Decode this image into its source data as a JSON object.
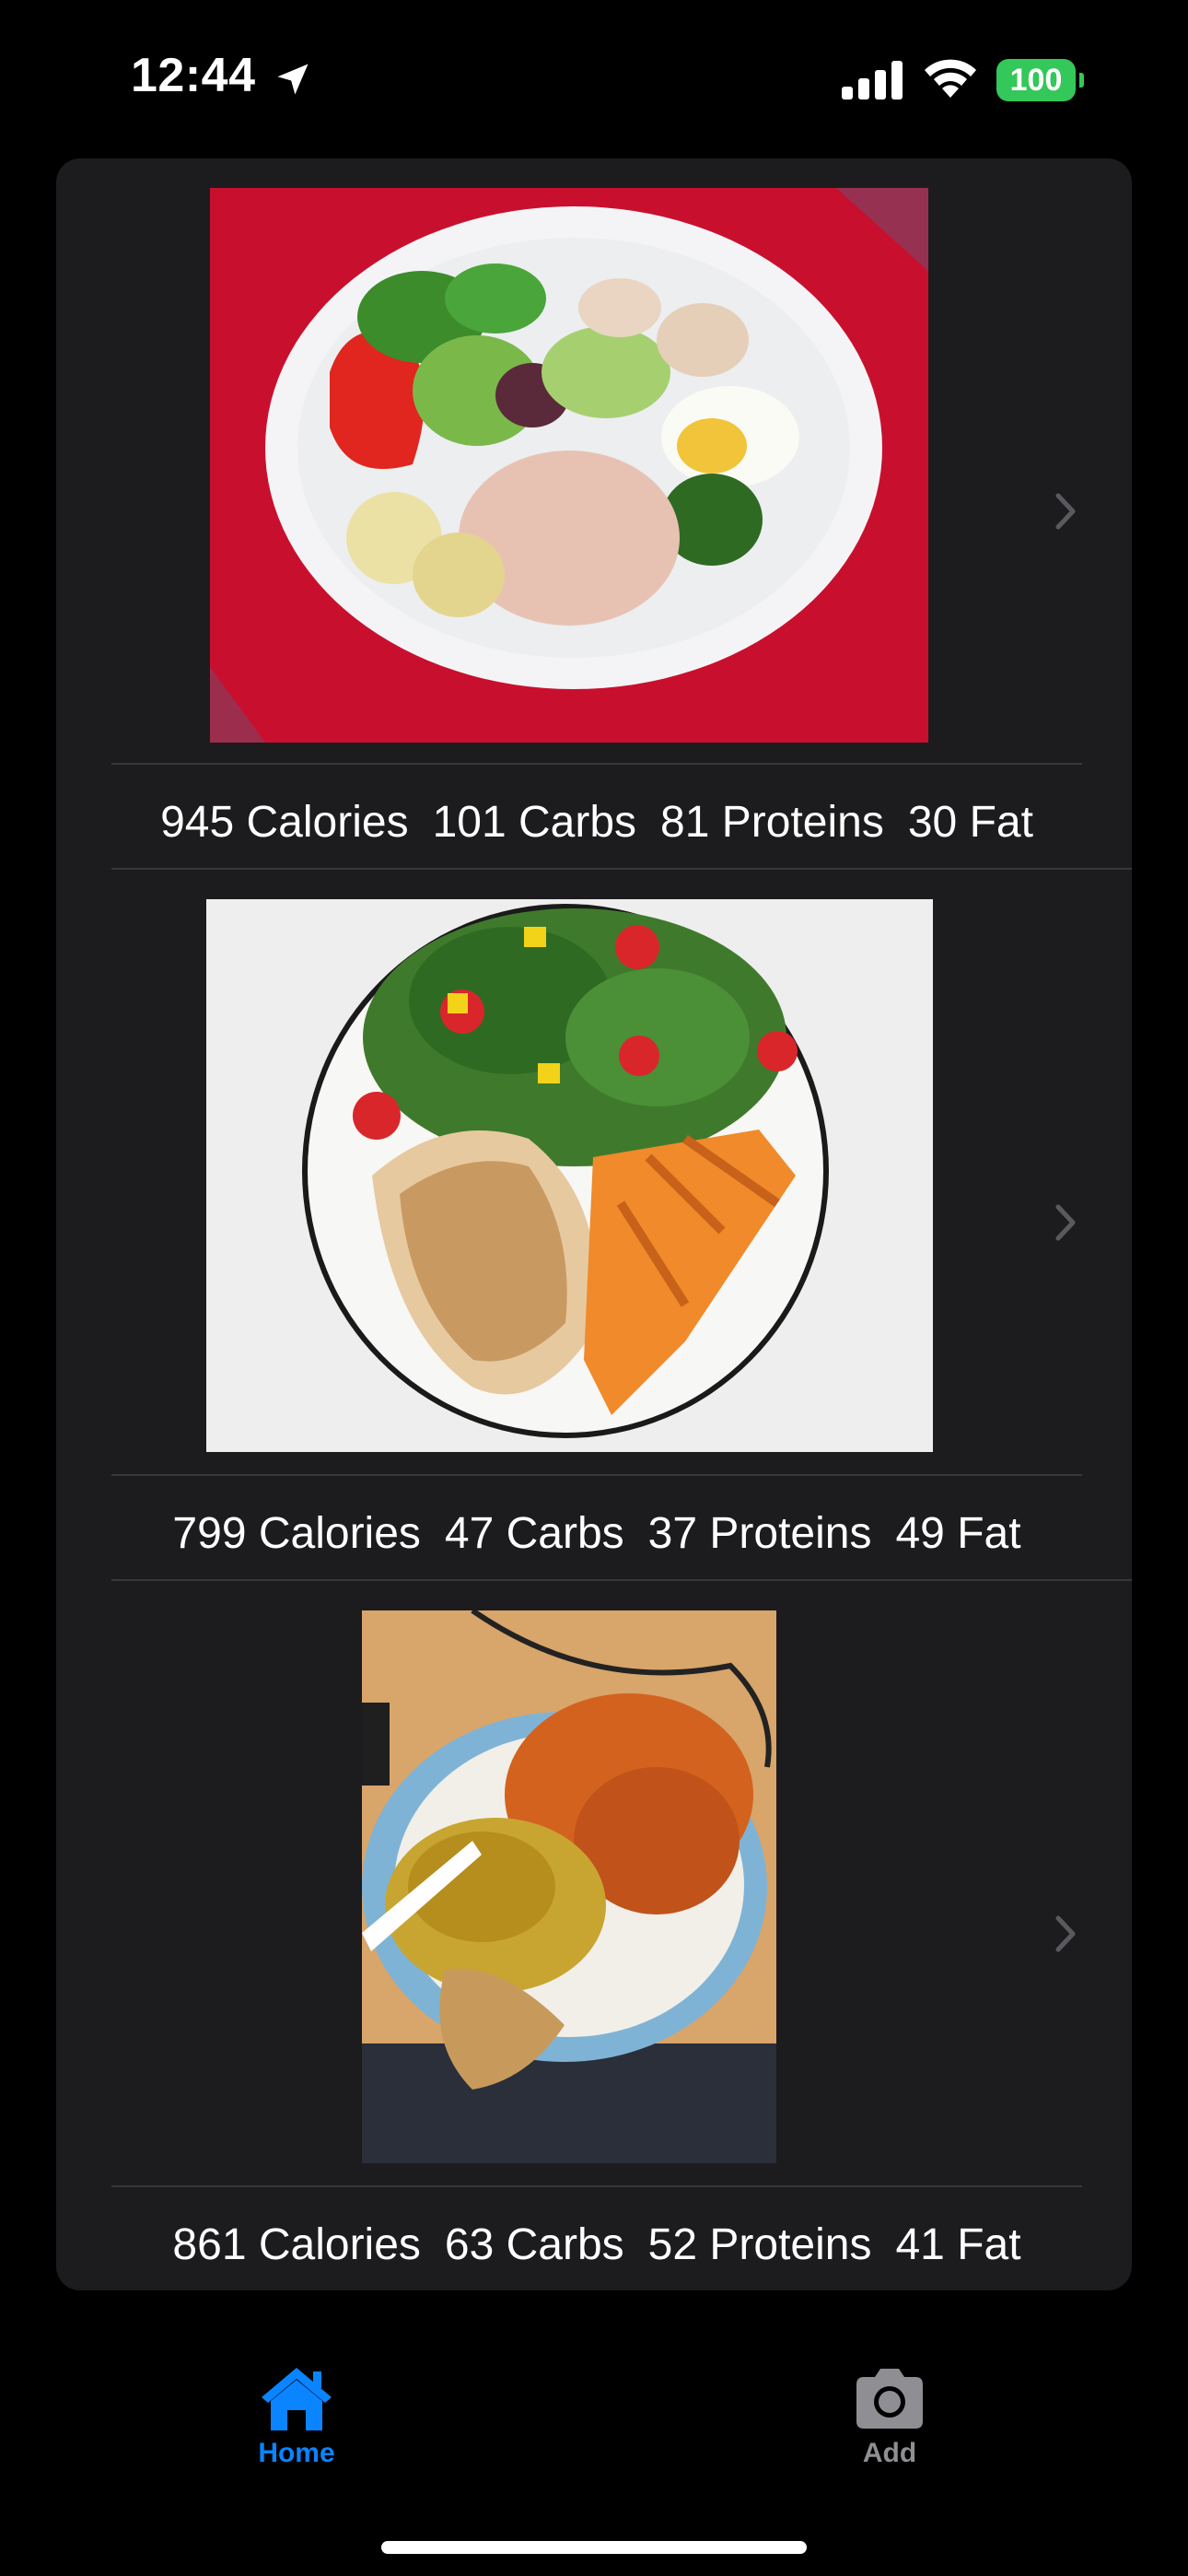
{
  "status_bar": {
    "time": "12:44",
    "battery_level": "100",
    "battery_color": "#34c759"
  },
  "meals": [
    {
      "photo_icon": "meal-photo-salad-plate",
      "calories": "945 Calories",
      "carbs": "101 Carbs",
      "proteins": "81 Proteins",
      "fat": "30 Fat"
    },
    {
      "photo_icon": "meal-photo-chicken-sweet-potato",
      "calories": "799 Calories",
      "carbs": "47 Carbs",
      "proteins": "37 Proteins",
      "fat": "49 Fat"
    },
    {
      "photo_icon": "meal-photo-curry-rice",
      "calories": "861 Calories",
      "carbs": "63 Carbs",
      "proteins": "52 Proteins",
      "fat": "41 Fat"
    }
  ],
  "tab_bar": {
    "home": {
      "label": "Home",
      "icon": "house-icon",
      "selected": true
    },
    "add": {
      "label": "Add",
      "icon": "camera-icon",
      "selected": false
    },
    "active_color": "#0a84ff",
    "inactive_color": "#8e8e93"
  }
}
